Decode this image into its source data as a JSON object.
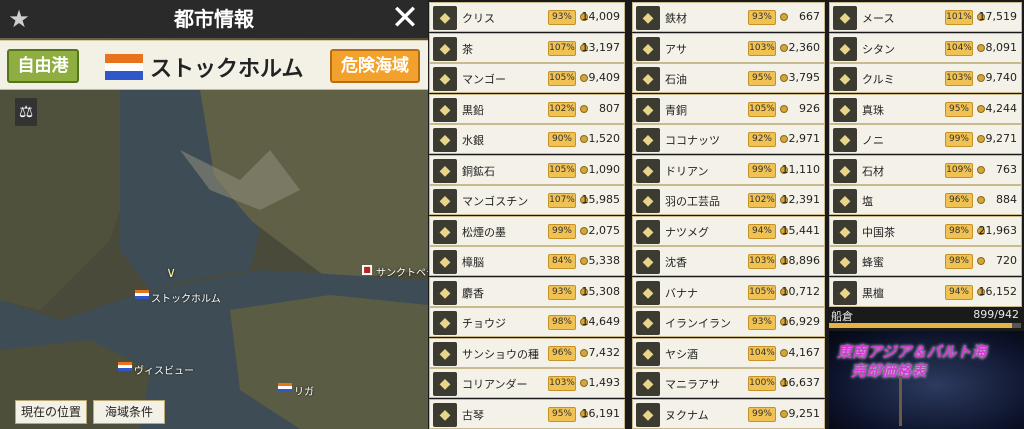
{
  "header": {
    "title": "都市情報"
  },
  "city": {
    "status": "自由港",
    "name": "ストックホルム",
    "danger": "危険海域",
    "flag_colors": [
      "#e9731c",
      "#ffffff",
      "#2f57c9"
    ]
  },
  "map": {
    "labels": {
      "stockholm": "ストックホルム",
      "visby": "ヴィスビュー",
      "riga": "リガ",
      "saintpetersburg": "サンクトペテ"
    },
    "buttons": {
      "current_pos": "現在の位置",
      "sea_conditions": "海域条件"
    }
  },
  "goods": {
    "col1": [
      {
        "name": "クリス",
        "pct": "93%",
        "price": "14,009",
        "icon": "kris-icon"
      },
      {
        "name": "茶",
        "pct": "107%",
        "price": "13,197",
        "icon": "tea-icon"
      },
      {
        "name": "マンゴー",
        "pct": "105%",
        "price": "9,409",
        "icon": "mango-icon"
      },
      {
        "name": "黒鉛",
        "pct": "102%",
        "price": "807",
        "icon": "graphite-icon"
      },
      {
        "name": "水銀",
        "pct": "90%",
        "price": "1,520",
        "icon": "mercury-icon"
      },
      {
        "name": "銅鉱石",
        "pct": "105%",
        "price": "1,090",
        "icon": "copper-ore-icon"
      },
      {
        "name": "マンゴスチン",
        "pct": "107%",
        "price": "15,985",
        "icon": "mangosteen-icon"
      },
      {
        "name": "松煙の墨",
        "pct": "99%",
        "price": "2,075",
        "icon": "ink-icon"
      },
      {
        "name": "樟脳",
        "pct": "84%",
        "price": "5,338",
        "icon": "camphor-icon"
      },
      {
        "name": "麝香",
        "pct": "93%",
        "price": "15,308",
        "icon": "musk-icon"
      },
      {
        "name": "チョウジ",
        "pct": "98%",
        "price": "14,649",
        "icon": "clove-icon"
      },
      {
        "name": "サンショウの種",
        "pct": "96%",
        "price": "7,432",
        "icon": "sansho-icon"
      },
      {
        "name": "コリアンダー",
        "pct": "103%",
        "price": "1,493",
        "icon": "coriander-icon"
      },
      {
        "name": "古琴",
        "pct": "95%",
        "price": "16,191",
        "icon": "guqin-icon"
      }
    ],
    "col2": [
      {
        "name": "鉄材",
        "pct": "93%",
        "price": "667",
        "icon": "iron-icon"
      },
      {
        "name": "アサ",
        "pct": "103%",
        "price": "2,360",
        "icon": "hemp-icon"
      },
      {
        "name": "石油",
        "pct": "95%",
        "price": "3,795",
        "icon": "oil-icon"
      },
      {
        "name": "青銅",
        "pct": "105%",
        "price": "926",
        "icon": "bronze-icon"
      },
      {
        "name": "ココナッツ",
        "pct": "92%",
        "price": "2,971",
        "icon": "coconut-icon"
      },
      {
        "name": "ドリアン",
        "pct": "99%",
        "price": "11,110",
        "icon": "durian-icon"
      },
      {
        "name": "羽の工芸品",
        "pct": "102%",
        "price": "12,391",
        "icon": "feather-craft-icon"
      },
      {
        "name": "ナツメグ",
        "pct": "94%",
        "price": "15,441",
        "icon": "nutmeg-icon"
      },
      {
        "name": "沈香",
        "pct": "103%",
        "price": "18,896",
        "icon": "agarwood-icon"
      },
      {
        "name": "バナナ",
        "pct": "105%",
        "price": "10,712",
        "icon": "banana-icon"
      },
      {
        "name": "イランイラン",
        "pct": "93%",
        "price": "16,929",
        "icon": "ylang-icon"
      },
      {
        "name": "ヤシ酒",
        "pct": "104%",
        "price": "4,167",
        "icon": "palm-wine-icon"
      },
      {
        "name": "マニラアサ",
        "pct": "100%",
        "price": "16,637",
        "icon": "manila-hemp-icon"
      },
      {
        "name": "ヌクナム",
        "pct": "99%",
        "price": "9,251",
        "icon": "nuoc-mam-icon"
      }
    ],
    "col3": [
      {
        "name": "メース",
        "pct": "101%",
        "price": "17,519",
        "icon": "mace-icon"
      },
      {
        "name": "シタン",
        "pct": "104%",
        "price": "8,091",
        "icon": "rosewood-icon"
      },
      {
        "name": "クルミ",
        "pct": "103%",
        "price": "9,740",
        "icon": "walnut-icon"
      },
      {
        "name": "真珠",
        "pct": "95%",
        "price": "4,244",
        "icon": "pearl-icon"
      },
      {
        "name": "ノニ",
        "pct": "99%",
        "price": "9,271",
        "icon": "noni-icon"
      },
      {
        "name": "石材",
        "pct": "109%",
        "price": "763",
        "icon": "stone-icon"
      },
      {
        "name": "塩",
        "pct": "96%",
        "price": "884",
        "icon": "salt-icon"
      },
      {
        "name": "中国茶",
        "pct": "98%",
        "price": "21,963",
        "icon": "chinese-tea-icon"
      },
      {
        "name": "蜂蜜",
        "pct": "98%",
        "price": "720",
        "icon": "honey-icon"
      },
      {
        "name": "黒檀",
        "pct": "94%",
        "price": "16,152",
        "icon": "ebony-icon"
      }
    ]
  },
  "hold": {
    "label": "船倉",
    "value": "899/942",
    "fill": 0.954
  },
  "promo": {
    "text": "東南アジア＆バルト海\n売却価格表"
  }
}
